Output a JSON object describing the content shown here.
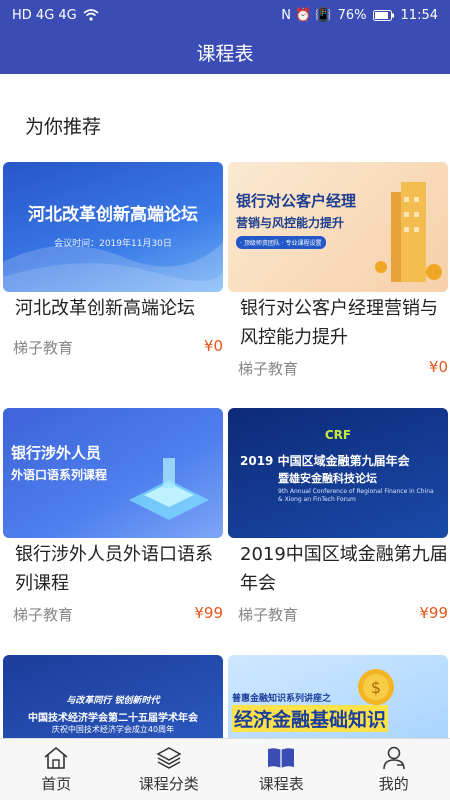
{
  "status": {
    "left": "HD 4G 4G",
    "right_icons": "N ⏰ 📳",
    "battery": "76%",
    "time": "11:54"
  },
  "header": {
    "title": "课程表"
  },
  "section": {
    "title": "为你推荐"
  },
  "cards": [
    {
      "title": "河北改革创新高端论坛",
      "org": "梯子教育",
      "price": "¥0",
      "banner": "河北改革创新高端论坛",
      "sub": "会议时间：2019年11月30日"
    },
    {
      "title": "银行对公客户经理营销与风控能力提升",
      "org": "梯子教育",
      "price": "¥0",
      "banner": "银行对公客户经理",
      "sub": "营销与风控能力提升",
      "tag": "· 顶级师资团队 · 专业课程设置"
    },
    {
      "title": "银行涉外人员外语口语系列课程",
      "org": "梯子教育",
      "price": "¥99",
      "banner": "银行涉外人员",
      "sub": "外语口语系列课程"
    },
    {
      "title": "2019中国区域金融第九届年会",
      "org": "梯子教育",
      "price": "¥99",
      "banner": "2019 中国区域金融第九届年会",
      "sub": "暨雄安金融科技论坛",
      "en": "9th Annual Conference of Regional Finance in China & Xiong an FinTech Forum",
      "logo": "CRF"
    },
    {
      "banner": "中国技术经济学会第二十五届学术年会",
      "sub": "庆祝中国技术经济学会成立40周年",
      "slogan": "与改革同行  锐创新时代"
    },
    {
      "banner": "经济金融基础知识",
      "sub": "普惠金融知识系列讲座之"
    }
  ],
  "tabs": [
    {
      "label": "首页",
      "icon": "home-icon"
    },
    {
      "label": "课程分类",
      "icon": "layers-icon"
    },
    {
      "label": "课程表",
      "icon": "book-icon"
    },
    {
      "label": "我的",
      "icon": "user-icon"
    }
  ]
}
